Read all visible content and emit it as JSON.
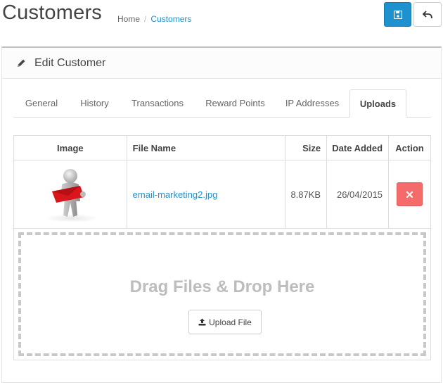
{
  "header": {
    "title": "Customers",
    "breadcrumb": [
      "Home",
      "Customers"
    ],
    "save_icon": "save-icon",
    "back_icon": "reply-icon"
  },
  "panel": {
    "heading": "Edit Customer",
    "heading_icon": "pencil-icon"
  },
  "tabs": [
    {
      "label": "General",
      "active": false
    },
    {
      "label": "History",
      "active": false
    },
    {
      "label": "Transactions",
      "active": false
    },
    {
      "label": "Reward Points",
      "active": false
    },
    {
      "label": "IP Addresses",
      "active": false
    },
    {
      "label": "Uploads",
      "active": true
    }
  ],
  "table": {
    "columns": [
      "Image",
      "File Name",
      "Size",
      "Date Added",
      "Action"
    ],
    "rows": [
      {
        "image": "person-holding-red-envelope-thumbnail",
        "file_name": "email-marketing2.jpg",
        "size": "8.87KB",
        "date_added": "26/04/2015",
        "action_icon": "delete-icon"
      }
    ]
  },
  "dropzone": {
    "text": "Drag Files & Drop Here",
    "upload_label": "Upload File",
    "upload_icon": "upload-icon"
  },
  "colors": {
    "primary": "#1e91cf",
    "danger": "#f56b6b",
    "link": "#1e91cf"
  }
}
